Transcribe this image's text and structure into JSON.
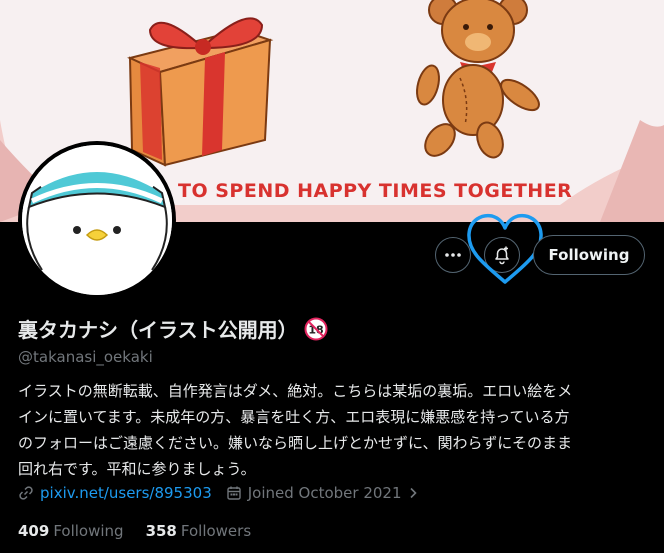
{
  "banner": {
    "caption": "TO SPEND HAPPY TIMES TOGETHER"
  },
  "actions": {
    "more_icon": "more-horizontal-icon",
    "notify_icon": "bell-plus-icon",
    "follow_label": "Following",
    "highlight_color": "#1d9bf0"
  },
  "profile": {
    "display_name": "裏タカナシ（イラスト公開用）",
    "age_badge": "18",
    "handle": "@takanasi_oekaki",
    "bio_lines": [
      "イラストの無断転載、自作発言はダメ、絶対。こちらは某垢の裏垢。エロい絵をメ",
      "インに置いてます。未成年の方、暴言を吐く方、エロ表現に嫌悪感を持っている方",
      "のフォローはご遠慮ください。嫌いなら晒し上げとかせずに、関わらずにそのまま",
      "回れ右です。平和に参りましょう。"
    ],
    "website": "pixiv.net/users/895303",
    "joined": "Joined October 2021"
  },
  "stats": {
    "following_count": "409",
    "following_label": "Following",
    "followers_count": "358",
    "followers_label": "Followers"
  }
}
